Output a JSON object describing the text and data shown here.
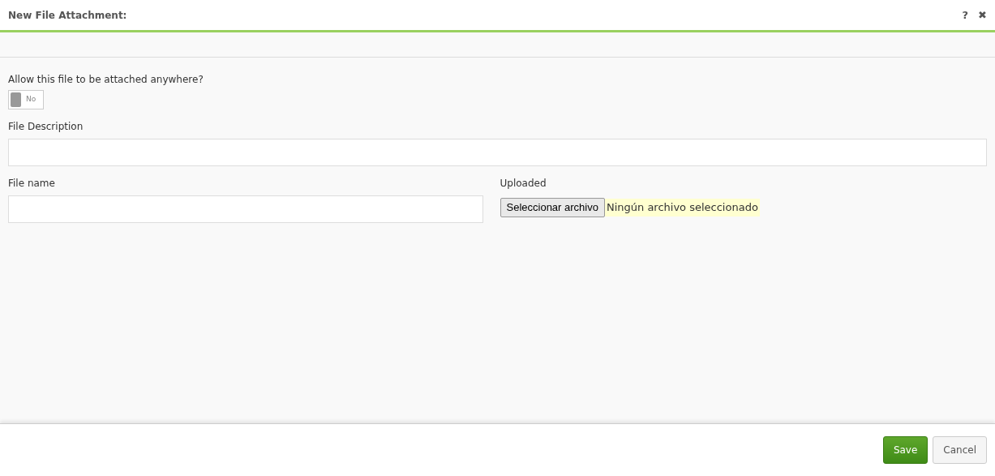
{
  "window": {
    "title": "New File Attachment:",
    "help": "?",
    "close": "✖"
  },
  "allow_anywhere": {
    "label": "Allow this file to be attached anywhere?",
    "on": false,
    "state_text": "No"
  },
  "file_description": {
    "label": "File Description"
  },
  "file_name": {
    "label": "File name"
  },
  "uploaded": {
    "label": "Uploaded",
    "button": "Seleccionar archivo",
    "status": "Ningún archivo seleccionado"
  },
  "buttons": [
    {
      "label": "Save",
      "kind": "primary"
    },
    {
      "label": "Cancel",
      "kind": "secondary"
    }
  ]
}
